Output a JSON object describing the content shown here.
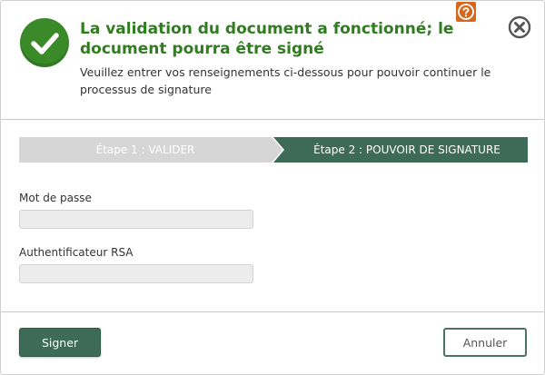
{
  "dialog": {
    "title": "La validation du document a fonctionné; le document pourra être signé",
    "subtitle": "Veuillez entrer vos renseignements ci-dessous pour pouvoir continuer le processus de signature",
    "icons": {
      "status": "check-circle-icon",
      "help": "help-icon",
      "close": "close-icon"
    }
  },
  "steps": [
    {
      "label": "Étape 1 : VALIDER",
      "state": "completed"
    },
    {
      "label": "Étape 2 : POUVOIR DE SIGNATURE",
      "state": "active"
    }
  ],
  "form": {
    "password": {
      "label": "Mot de passe",
      "value": "",
      "placeholder": ""
    },
    "rsa": {
      "label": "Authentificateur RSA",
      "value": "",
      "placeholder": ""
    }
  },
  "buttons": {
    "sign": "Signer",
    "cancel": "Annuler"
  },
  "colors": {
    "success_green": "#2f7d1f",
    "check_circle": "#3a8a2a",
    "step_active": "#3e6b58",
    "step_inactive": "#d6d6d6",
    "help_orange": "#d2691e"
  }
}
